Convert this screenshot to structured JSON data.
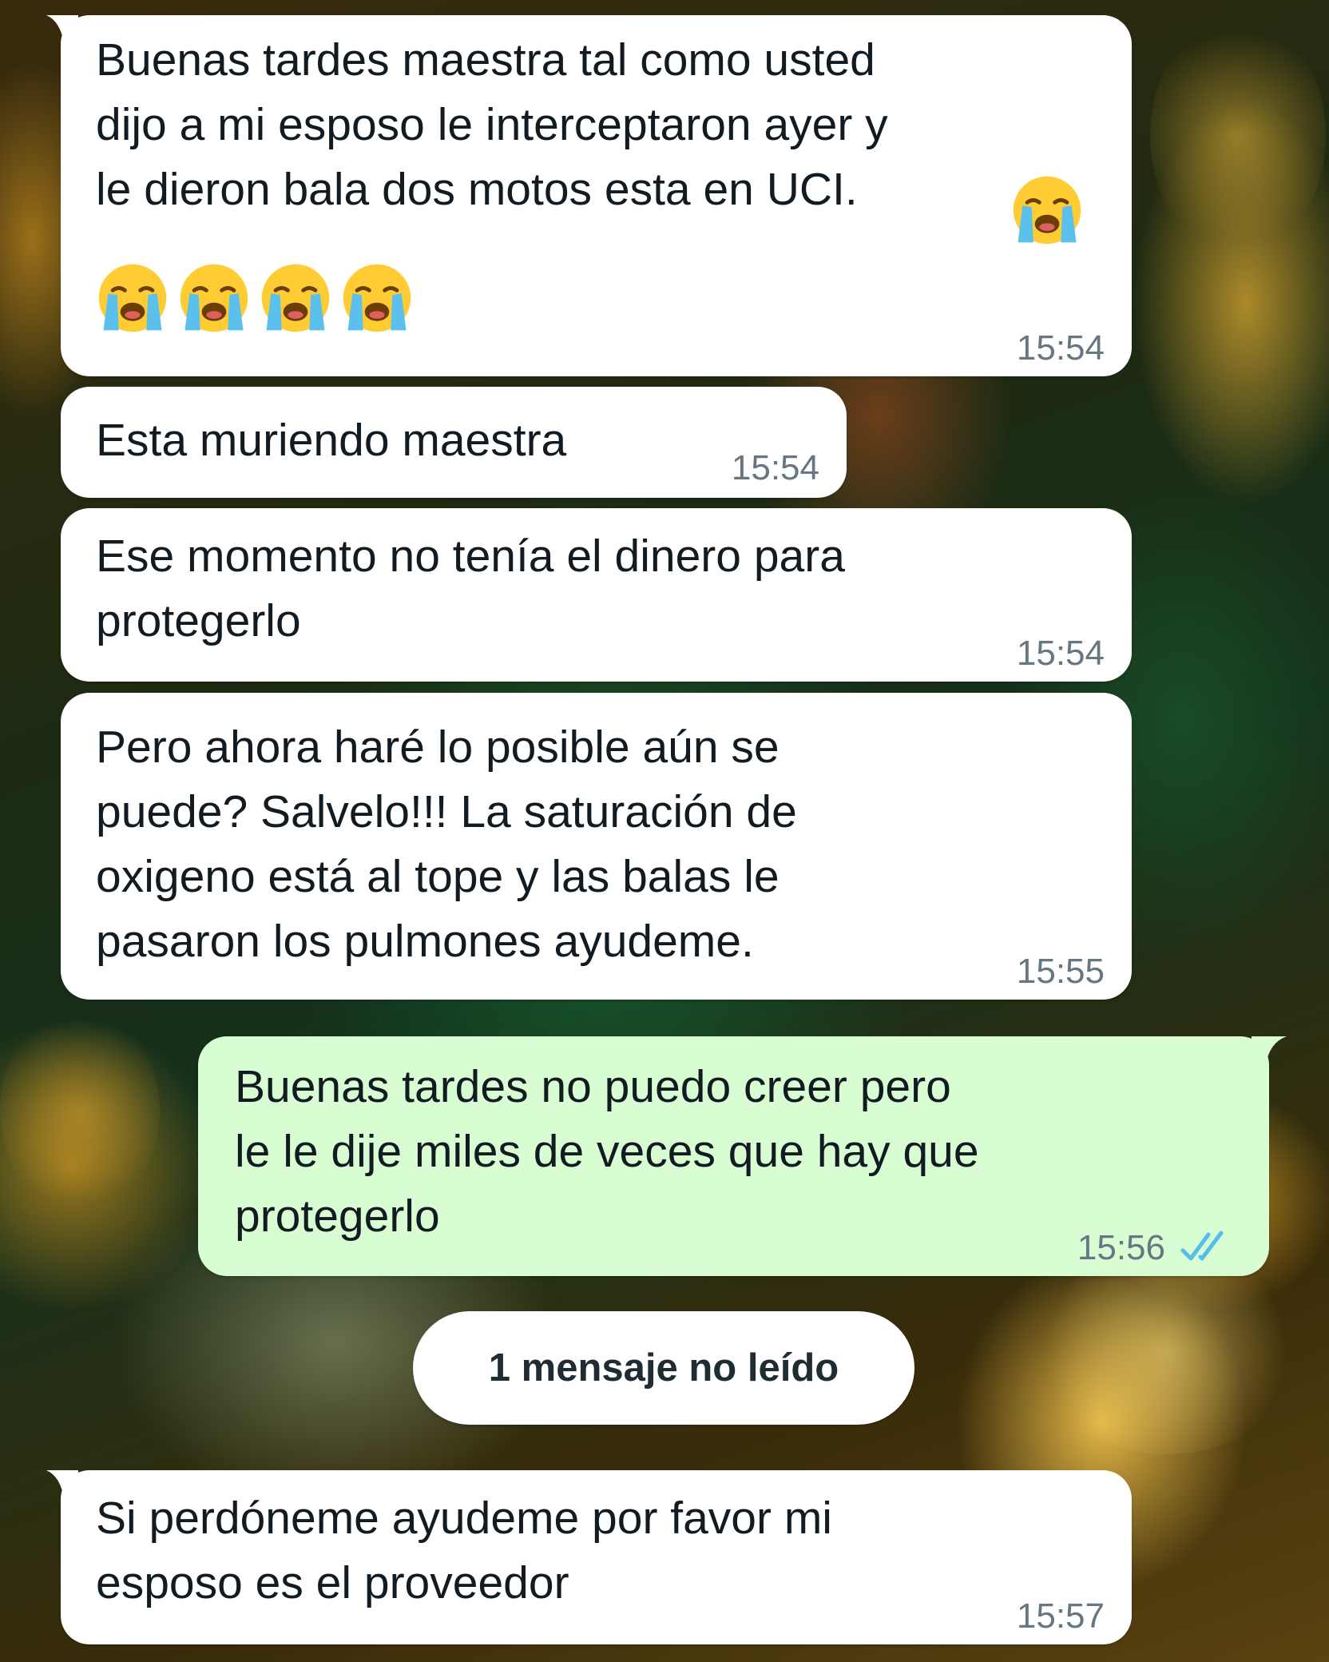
{
  "messages": [
    {
      "direction": "incoming",
      "text": "Buenas tardes maestra tal como usted\ndijo a mi esposo le interceptaron ayer y\nle dieron bala dos motos esta en UCI.",
      "emoji": "loudly-crying-face",
      "emoji_count": 5,
      "time": "15:54"
    },
    {
      "direction": "incoming",
      "text": "Esta muriendo maestra",
      "time": "15:54"
    },
    {
      "direction": "incoming",
      "text": "Ese momento no tenía el dinero para\nprotegerlo",
      "time": "15:54"
    },
    {
      "direction": "incoming",
      "text": "Pero ahora haré lo posible aún se\npuede? Salvelo!!! La saturación de\noxigeno está al tope y las balas le\npasaron los pulmones ayudeme.",
      "time": "15:55"
    },
    {
      "direction": "outgoing",
      "text": "Buenas tardes no puedo creer pero\nle le dije miles de veces que hay que\nprotegerlo",
      "time": "15:56",
      "status": "read"
    },
    {
      "direction": "incoming",
      "text": "Si perdóneme ayudeme por favor mi\nesposo es el proveedor",
      "time": "15:57"
    }
  ],
  "unread_divider": "1 mensaje no leído",
  "colors": {
    "incoming_bubble": "#ffffff",
    "outgoing_bubble": "#d9fdd3",
    "timestamp": "#667781",
    "read_ticks": "#53bdeb"
  }
}
